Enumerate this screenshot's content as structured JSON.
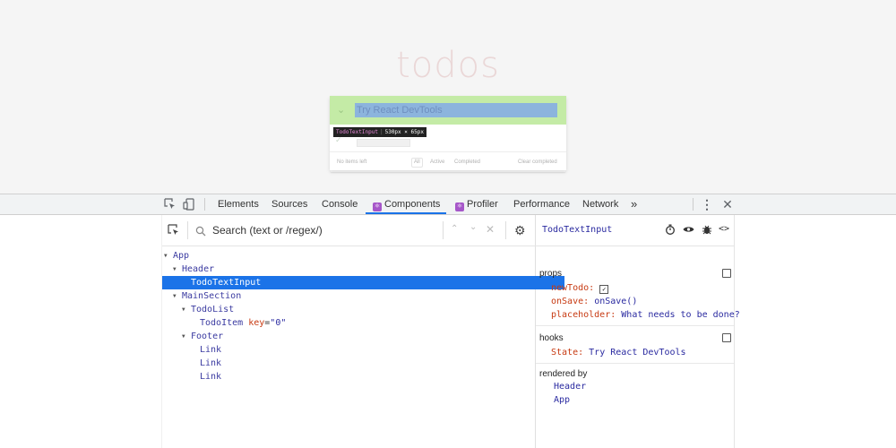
{
  "page": {
    "title": "todos",
    "input_value": "Try React DevTools",
    "toggle_all_glyph": "⌄",
    "inspect_tooltip": {
      "name": "TodoTextInput",
      "size": "530px × 65px"
    },
    "todo_check_glyph": "✓",
    "footer": {
      "count": "No items left",
      "filter_all": "All",
      "filter_active": "Active",
      "filter_completed": "Completed",
      "clear": "Clear completed"
    }
  },
  "devtools": {
    "tabs": [
      {
        "label": "Elements"
      },
      {
        "label": "Sources"
      },
      {
        "label": "Console"
      },
      {
        "label": "Components",
        "react": true,
        "active": true
      },
      {
        "label": "Profiler",
        "react": true
      },
      {
        "label": "Performance"
      },
      {
        "label": "Network"
      },
      {
        "label": "»"
      }
    ],
    "search_placeholder": "Search (text or /regex/)",
    "tree": [
      {
        "name": "App",
        "arrow": true
      },
      {
        "name": "Header",
        "arrow": true
      },
      {
        "name": "TodoTextInput",
        "selected": true
      },
      {
        "name": "MainSection",
        "arrow": true
      },
      {
        "name": "TodoList",
        "arrow": true
      },
      {
        "name": "TodoItem",
        "key_attr": "key",
        "key_val": "\"0\""
      },
      {
        "name": "Footer",
        "arrow": true
      },
      {
        "name": "Link"
      },
      {
        "name": "Link"
      },
      {
        "name": "Link"
      }
    ],
    "inspector": {
      "component": "TodoTextInput",
      "props_label": "props",
      "props": [
        {
          "key": "newTodo:",
          "checkbox": "✓"
        },
        {
          "key": "onSave:",
          "value": "onSave()"
        },
        {
          "key": "placeholder:",
          "value": "What needs to be done?"
        }
      ],
      "hooks_label": "hooks",
      "hooks": [
        {
          "key": "State:",
          "value": "Try React DevTools"
        }
      ],
      "rendered_by_label": "rendered by",
      "rendered_by": [
        "Header",
        "App"
      ]
    },
    "icons": {
      "inspect": "inspect-element-icon",
      "device": "device-toolbar-icon",
      "menu": "kebab-menu-icon",
      "close": "close-icon"
    }
  }
}
